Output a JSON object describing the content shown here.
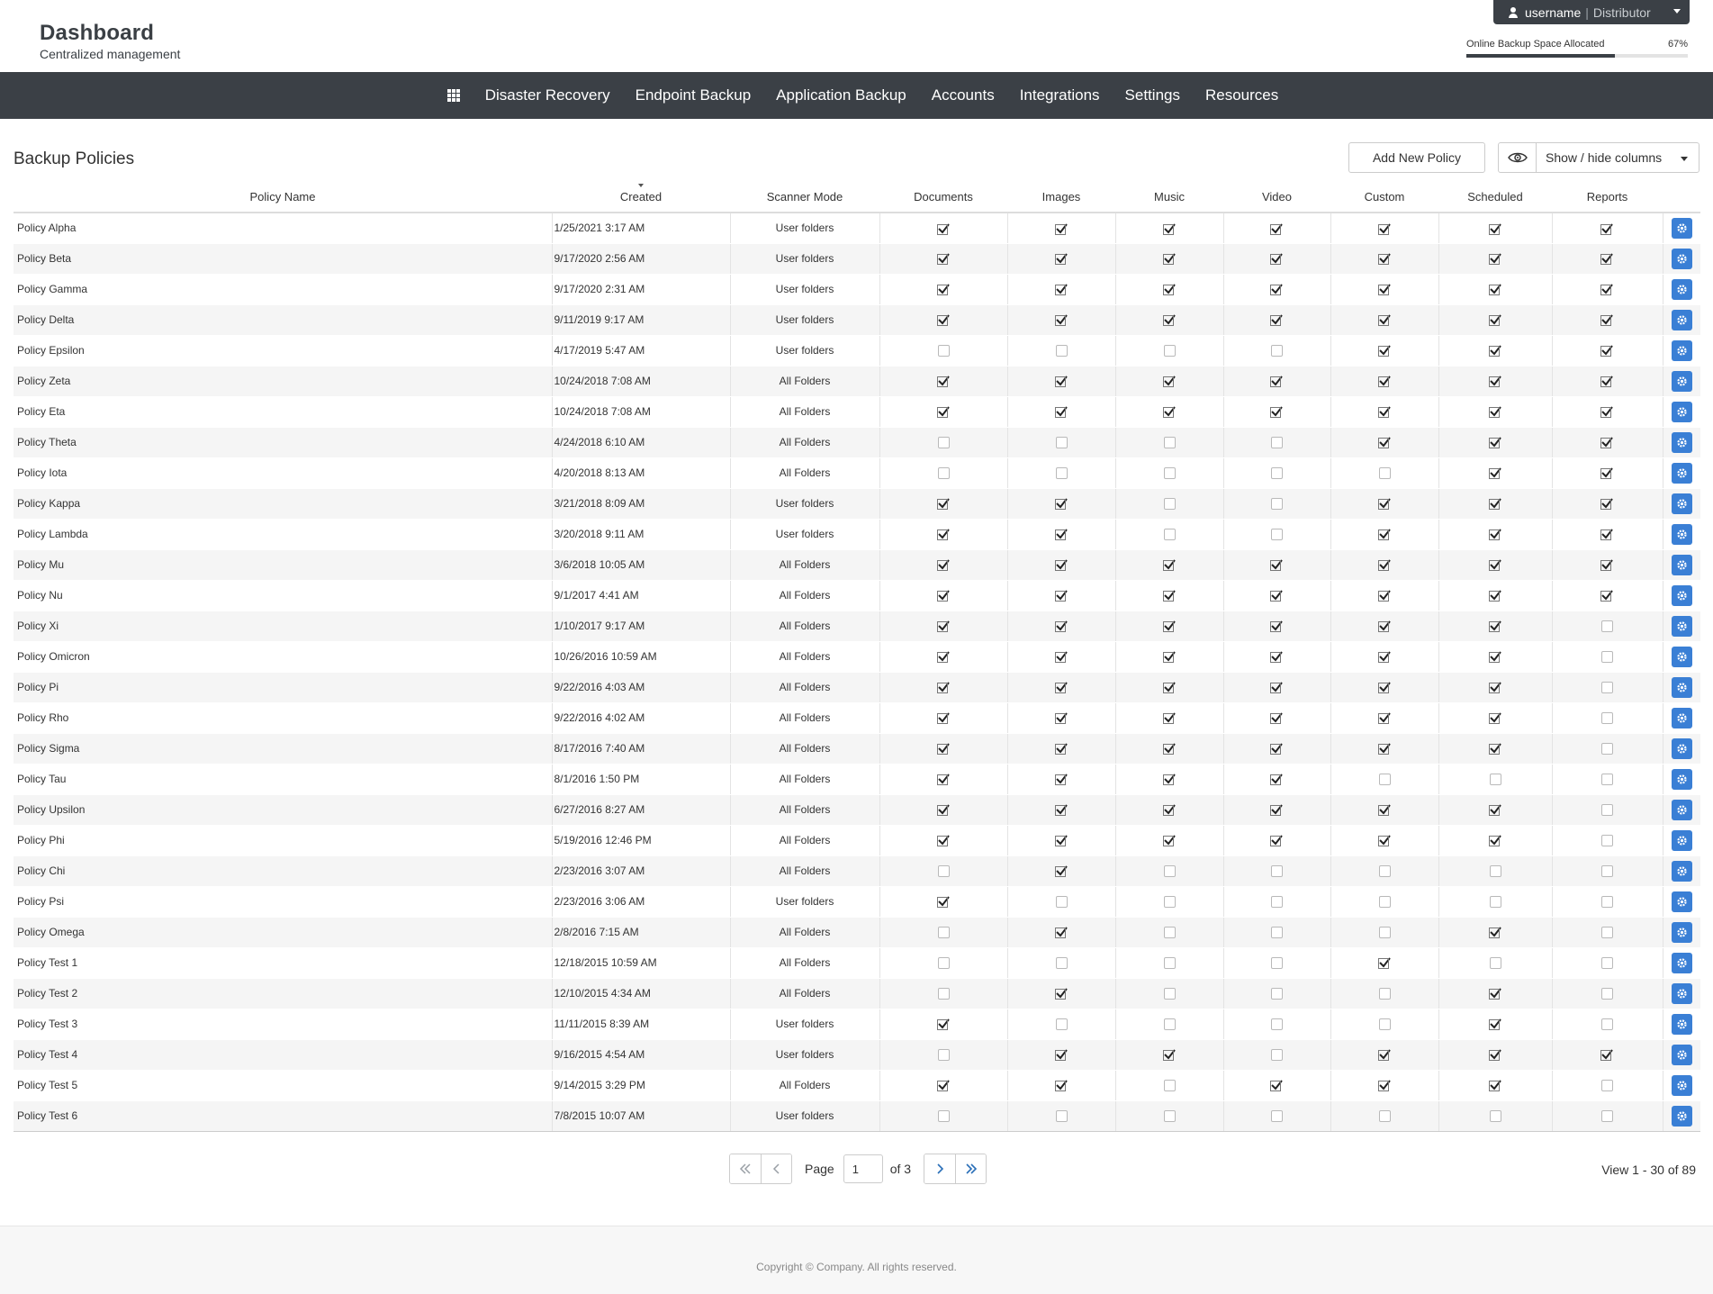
{
  "header": {
    "title": "Dashboard",
    "subtitle": "Centralized management",
    "user": {
      "name": "username",
      "separator": "|",
      "role": "Distributor"
    },
    "storage": {
      "label": "Online Backup Space Allocated",
      "percent_label": "67%",
      "percent": 0.67
    }
  },
  "nav": {
    "items": [
      "Disaster Recovery",
      "Endpoint Backup",
      "Application Backup",
      "Accounts",
      "Integrations",
      "Settings",
      "Resources"
    ]
  },
  "page": {
    "title": "Backup Policies",
    "add_button": "Add New Policy",
    "columns_button": "Show / hide columns"
  },
  "table": {
    "columns": [
      "Policy Name",
      "Created",
      "Scanner Mode",
      "Documents",
      "Images",
      "Music",
      "Video",
      "Custom",
      "Scheduled",
      "Reports"
    ],
    "sorted_column": "Created",
    "rows": [
      {
        "name": "Policy Alpha",
        "created": "1/25/2021 3:17 AM",
        "mode": "User folders",
        "flags": [
          1,
          1,
          1,
          1,
          1,
          1,
          1
        ]
      },
      {
        "name": "Policy Beta",
        "created": "9/17/2020 2:56 AM",
        "mode": "User folders",
        "flags": [
          1,
          1,
          1,
          1,
          1,
          1,
          1
        ]
      },
      {
        "name": "Policy Gamma",
        "created": "9/17/2020 2:31 AM",
        "mode": "User folders",
        "flags": [
          1,
          1,
          1,
          1,
          1,
          1,
          1
        ]
      },
      {
        "name": "Policy Delta",
        "created": "9/11/2019 9:17 AM",
        "mode": "User folders",
        "flags": [
          1,
          1,
          1,
          1,
          1,
          1,
          1
        ]
      },
      {
        "name": "Policy Epsilon",
        "created": "4/17/2019 5:47 AM",
        "mode": "User folders",
        "flags": [
          0,
          0,
          0,
          0,
          1,
          1,
          1
        ]
      },
      {
        "name": "Policy Zeta",
        "created": "10/24/2018 7:08 AM",
        "mode": "All Folders",
        "flags": [
          1,
          1,
          1,
          1,
          1,
          1,
          1
        ]
      },
      {
        "name": "Policy Eta",
        "created": "10/24/2018 7:08 AM",
        "mode": "All Folders",
        "flags": [
          1,
          1,
          1,
          1,
          1,
          1,
          1
        ]
      },
      {
        "name": "Policy Theta",
        "created": "4/24/2018 6:10 AM",
        "mode": "All Folders",
        "flags": [
          0,
          0,
          0,
          0,
          1,
          1,
          1
        ]
      },
      {
        "name": "Policy Iota",
        "created": "4/20/2018 8:13 AM",
        "mode": "All Folders",
        "flags": [
          0,
          0,
          0,
          0,
          0,
          1,
          1
        ]
      },
      {
        "name": "Policy Kappa",
        "created": "3/21/2018 8:09 AM",
        "mode": "User folders",
        "flags": [
          1,
          1,
          0,
          0,
          1,
          1,
          1
        ]
      },
      {
        "name": "Policy Lambda",
        "created": "3/20/2018 9:11 AM",
        "mode": "User folders",
        "flags": [
          1,
          1,
          0,
          0,
          1,
          1,
          1
        ]
      },
      {
        "name": "Policy Mu",
        "created": "3/6/2018 10:05 AM",
        "mode": "All Folders",
        "flags": [
          1,
          1,
          1,
          1,
          1,
          1,
          1
        ]
      },
      {
        "name": "Policy Nu",
        "created": "9/1/2017 4:41 AM",
        "mode": "All Folders",
        "flags": [
          1,
          1,
          1,
          1,
          1,
          1,
          1
        ]
      },
      {
        "name": "Policy Xi",
        "created": "1/10/2017 9:17 AM",
        "mode": "All Folders",
        "flags": [
          1,
          1,
          1,
          1,
          1,
          1,
          0
        ]
      },
      {
        "name": "Policy Omicron",
        "created": "10/26/2016 10:59 AM",
        "mode": "All Folders",
        "flags": [
          1,
          1,
          1,
          1,
          1,
          1,
          0
        ]
      },
      {
        "name": "Policy Pi",
        "created": "9/22/2016 4:03 AM",
        "mode": "All Folders",
        "flags": [
          1,
          1,
          1,
          1,
          1,
          1,
          0
        ]
      },
      {
        "name": "Policy Rho",
        "created": "9/22/2016 4:02 AM",
        "mode": "All Folders",
        "flags": [
          1,
          1,
          1,
          1,
          1,
          1,
          0
        ]
      },
      {
        "name": "Policy Sigma",
        "created": "8/17/2016 7:40 AM",
        "mode": "All Folders",
        "flags": [
          1,
          1,
          1,
          1,
          1,
          1,
          0
        ]
      },
      {
        "name": "Policy Tau",
        "created": "8/1/2016 1:50 PM",
        "mode": "All Folders",
        "flags": [
          1,
          1,
          1,
          1,
          0,
          0,
          0
        ]
      },
      {
        "name": "Policy Upsilon",
        "created": "6/27/2016 8:27 AM",
        "mode": "All Folders",
        "flags": [
          1,
          1,
          1,
          1,
          1,
          1,
          0
        ]
      },
      {
        "name": "Policy Phi",
        "created": "5/19/2016 12:46 PM",
        "mode": "All Folders",
        "flags": [
          1,
          1,
          1,
          1,
          1,
          1,
          0
        ]
      },
      {
        "name": "Policy Chi",
        "created": "2/23/2016 3:07 AM",
        "mode": "All Folders",
        "flags": [
          0,
          1,
          0,
          0,
          0,
          0,
          0
        ]
      },
      {
        "name": "Policy Psi",
        "created": "2/23/2016 3:06 AM",
        "mode": "User folders",
        "flags": [
          1,
          0,
          0,
          0,
          0,
          0,
          0
        ]
      },
      {
        "name": "Policy Omega",
        "created": "2/8/2016 7:15 AM",
        "mode": "All Folders",
        "flags": [
          0,
          1,
          0,
          0,
          0,
          1,
          0
        ]
      },
      {
        "name": "Policy Test 1",
        "created": "12/18/2015 10:59 AM",
        "mode": "All Folders",
        "flags": [
          0,
          0,
          0,
          0,
          1,
          0,
          0
        ]
      },
      {
        "name": "Policy Test 2",
        "created": "12/10/2015 4:34 AM",
        "mode": "All Folders",
        "flags": [
          0,
          1,
          0,
          0,
          0,
          1,
          0
        ]
      },
      {
        "name": "Policy Test 3",
        "created": "11/11/2015 8:39 AM",
        "mode": "User folders",
        "flags": [
          1,
          0,
          0,
          0,
          0,
          1,
          0
        ]
      },
      {
        "name": "Policy Test 4",
        "created": "9/16/2015 4:54 AM",
        "mode": "User folders",
        "flags": [
          0,
          1,
          1,
          0,
          1,
          1,
          1
        ]
      },
      {
        "name": "Policy Test 5",
        "created": "9/14/2015 3:29 PM",
        "mode": "All Folders",
        "flags": [
          1,
          1,
          0,
          1,
          1,
          1,
          0
        ]
      },
      {
        "name": "Policy Test 6",
        "created": "7/8/2015 10:07 AM",
        "mode": "User folders",
        "flags": [
          0,
          0,
          0,
          0,
          0,
          0,
          0
        ]
      }
    ]
  },
  "pagination": {
    "page_label": "Page",
    "current_page": "1",
    "of_label": "of 3",
    "view_label": "View 1 - 30 of 89"
  },
  "footer": {
    "copyright": "Copyright ©  Company.  All rights reserved."
  },
  "icons": {
    "apps": "apps-grid-icon",
    "user": "user-icon",
    "eye": "eye-icon",
    "gear": "gear-icon",
    "check": "checkmark-icon"
  },
  "colors": {
    "nav_bg": "#3b4046",
    "accent": "#3a7fd5",
    "stripe": "#f5f5f5"
  }
}
